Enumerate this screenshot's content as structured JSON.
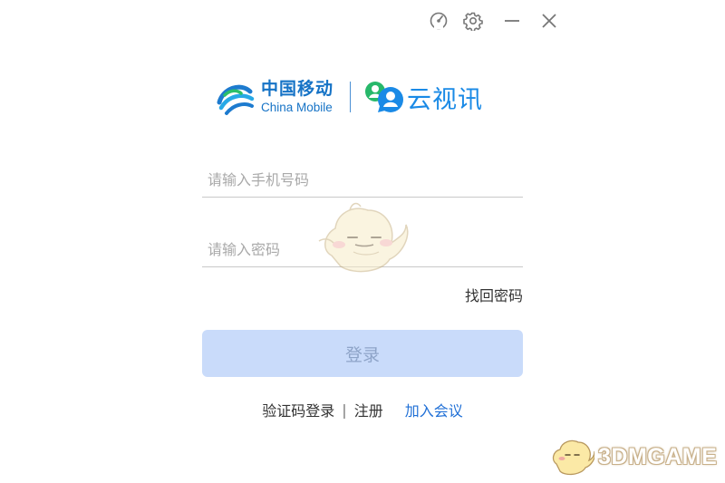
{
  "window": {
    "controls": {
      "monitor": "speedometer-icon",
      "settings": "gear-icon",
      "minimize": "minimize-icon",
      "close": "close-icon"
    }
  },
  "brand": {
    "china_mobile_cn": "中国移动",
    "china_mobile_en": "China Mobile",
    "product_name": "云视讯"
  },
  "login": {
    "phone_placeholder": "请输入手机号码",
    "phone_value": "",
    "password_placeholder": "请输入密码",
    "password_value": "",
    "forgot_password": "找回密码",
    "login_button": "登录",
    "sms_login": "验证码登录",
    "separator": "|",
    "register": "注册",
    "join_meeting": "加入会议"
  },
  "watermark": {
    "text": "3DMGAME"
  },
  "colors": {
    "brand_blue": "#1673c6",
    "product_blue": "#1a8ae6",
    "login_button_disabled": "#c9dbfa",
    "link_blue": "#1f6fd6"
  }
}
